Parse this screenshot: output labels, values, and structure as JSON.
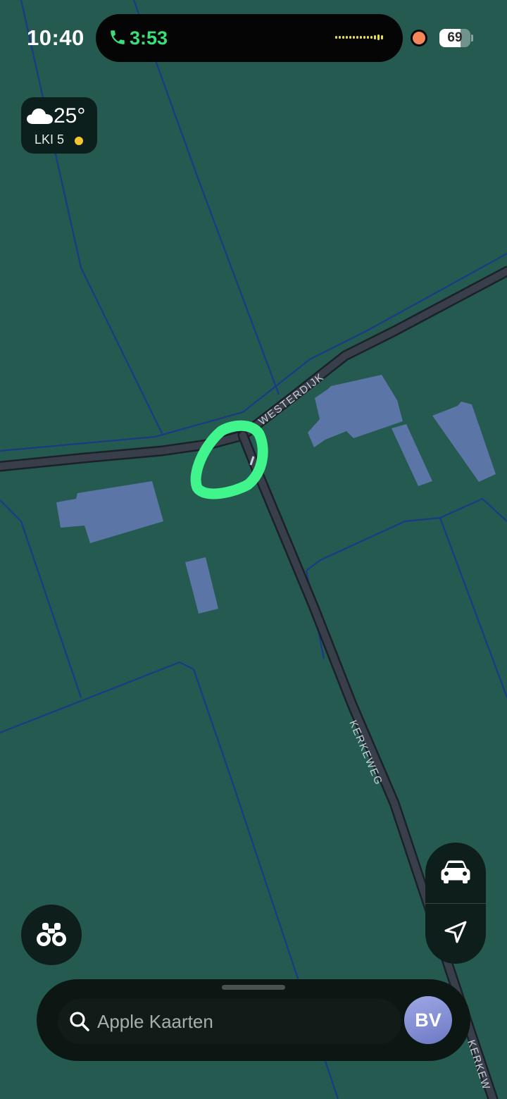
{
  "status_bar": {
    "time": "10:40",
    "call_timer": "3:53",
    "battery_level": "69",
    "battery_fraction": 0.69
  },
  "weather": {
    "temperature": "25°",
    "air_quality": "LKI 5",
    "condition_icon": "cloud-icon",
    "air_quality_color": "#f7c531"
  },
  "map": {
    "roads": [
      {
        "name": "WESTERDIJK"
      },
      {
        "name": "KERKEWEG"
      },
      {
        "name": "KERKEW"
      }
    ],
    "highlight_color": "#3ff58c",
    "land_color": "#245a50",
    "parcel_line_color": "#1b3a86",
    "building_color": "#5a75a6"
  },
  "controls": {
    "look_around_icon": "binoculars-icon",
    "driving_mode_icon": "car-icon",
    "location_icon": "location-arrow-icon"
  },
  "search": {
    "placeholder": "Apple Kaarten",
    "avatar_initials": "BV"
  }
}
